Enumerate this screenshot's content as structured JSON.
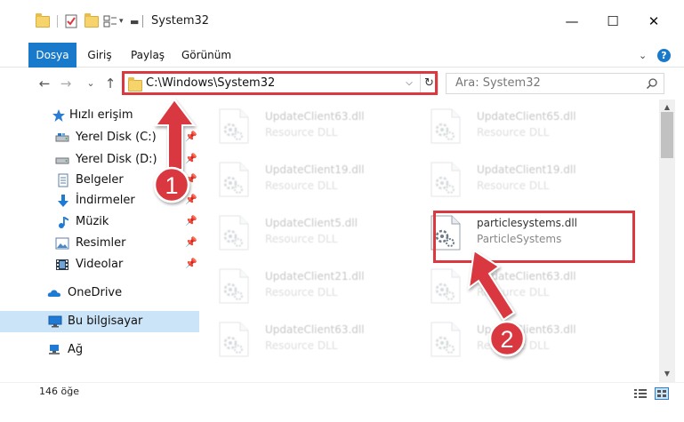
{
  "window": {
    "title": "System32",
    "minimize_glyph": "—",
    "maximize_glyph": "☐",
    "close_glyph": "✕"
  },
  "ribbon": {
    "tabs": [
      {
        "label": "Dosya"
      },
      {
        "label": "Giriş"
      },
      {
        "label": "Paylaş"
      },
      {
        "label": "Görünüm"
      }
    ],
    "help_glyph": "?",
    "collapse_glyph": "⌄"
  },
  "address_bar": {
    "path": "C:\\Windows\\System32",
    "dropdown_glyph": "⌵",
    "refresh_glyph": "↻"
  },
  "search": {
    "placeholder": "Ara: System32"
  },
  "nav_buttons": {
    "back": "←",
    "forward": "→",
    "recent": "⌄",
    "up": "↑"
  },
  "nav_pane": {
    "quick_access": "Hızlı erişim",
    "items": [
      {
        "label": "Yerel Disk (C:)",
        "icon": "drive-icon",
        "pinned": true
      },
      {
        "label": "Yerel Disk (D:)",
        "icon": "drive-icon",
        "pinned": true
      },
      {
        "label": "Belgeler",
        "icon": "documents-icon",
        "pinned": true
      },
      {
        "label": "İndirmeler",
        "icon": "downloads-icon",
        "pinned": true
      },
      {
        "label": "Müzik",
        "icon": "music-icon",
        "pinned": true
      },
      {
        "label": "Resimler",
        "icon": "pictures-icon",
        "pinned": true
      },
      {
        "label": "Videolar",
        "icon": "videos-icon",
        "pinned": true
      }
    ],
    "onedrive": "OneDrive",
    "this_pc": "Bu bilgisayar",
    "network": "Ağ"
  },
  "files": [
    {
      "name": "UpdateClient63.dll",
      "desc": "Resource DLL",
      "highlighted": false
    },
    {
      "name": "UpdateClient65.dll",
      "desc": "Resource DLL",
      "highlighted": false
    },
    {
      "name": "UpdateClient19.dll",
      "desc": "Resource DLL",
      "highlighted": false
    },
    {
      "name": "UpdateClient19.dll",
      "desc": "Resource DLL",
      "highlighted": false
    },
    {
      "name": "UpdateClient5.dll",
      "desc": "Resource DLL",
      "highlighted": false
    },
    {
      "name": "particlesystems.dll",
      "desc": "ParticleSystems",
      "highlighted": true
    },
    {
      "name": "UpdateClient21.dll",
      "desc": "Resource DLL",
      "highlighted": false
    },
    {
      "name": "UpdateClient63.dll",
      "desc": "Resource DLL",
      "highlighted": false
    },
    {
      "name": "UpdateClient63.dll",
      "desc": "Resource DLL",
      "highlighted": false
    },
    {
      "name": "UpdateClient63.dll",
      "desc": "Resource DLL",
      "highlighted": false
    }
  ],
  "status": {
    "item_count": "146 öğe"
  },
  "annotations": {
    "marker1": "1",
    "marker2": "2",
    "color": "#d9393f"
  }
}
